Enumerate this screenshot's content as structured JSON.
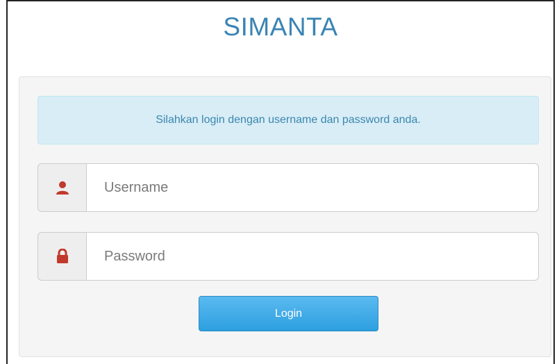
{
  "app": {
    "title": "SIMANTA"
  },
  "login": {
    "message": "Silahkan login dengan username dan password anda.",
    "username_placeholder": "Username",
    "password_placeholder": "Password",
    "username_value": "",
    "password_value": "",
    "login_label": "Login",
    "user_icon": "user-icon",
    "lock_icon": "lock-icon"
  },
  "colors": {
    "title": "#3a84b4",
    "alert_bg": "#d9edf7",
    "alert_text": "#3a87ad",
    "icon": "#c0392b",
    "button": "#2d9fe0"
  }
}
